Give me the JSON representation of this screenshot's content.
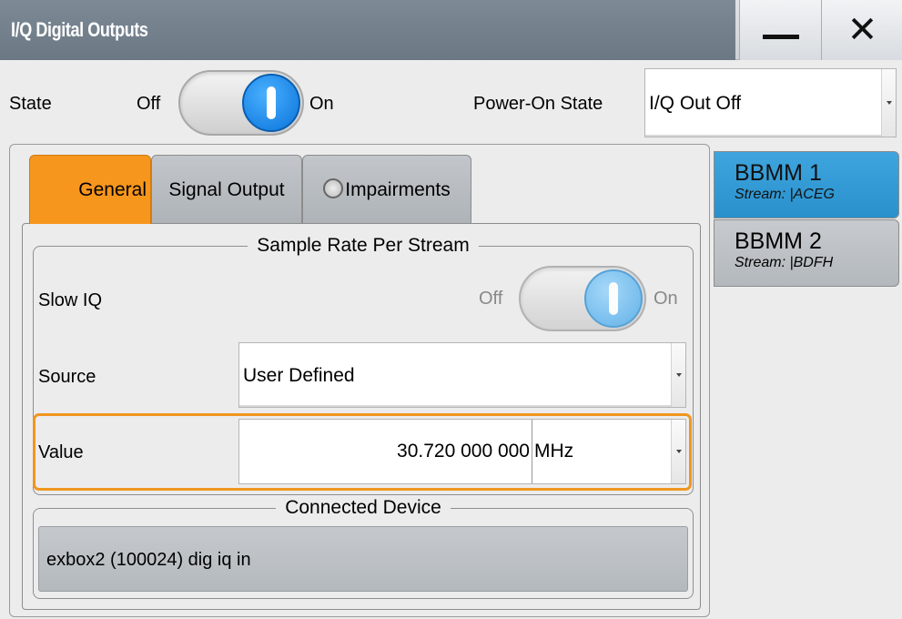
{
  "window": {
    "title": "I/Q Digital Outputs",
    "minimize_icon": "minimize-icon",
    "close_label": "✕"
  },
  "state": {
    "label": "State",
    "off_label": "Off",
    "on_label": "On",
    "value": "On"
  },
  "power_on_state": {
    "label": "Power-On State",
    "value": "I/Q Out Off"
  },
  "tabs": [
    {
      "label": "General",
      "active": true
    },
    {
      "label": "Signal Output",
      "active": false
    },
    {
      "label": "Impairments",
      "active": false,
      "icon": "indicator-circle-icon"
    }
  ],
  "sample_rate": {
    "title": "Sample Rate Per Stream",
    "slow_iq": {
      "label": "Slow IQ",
      "off_label": "Off",
      "on_label": "On",
      "value": "On"
    },
    "source": {
      "label": "Source",
      "value": "User Defined"
    },
    "value": {
      "label": "Value",
      "number": "30.720 000 000",
      "unit": "MHz"
    }
  },
  "connected_device": {
    "title": "Connected Device",
    "value": "exbox2 (100024) dig iq in"
  },
  "streams": [
    {
      "title": "BBMM 1",
      "subtitle": "Stream: |ACEG",
      "selected": true
    },
    {
      "title": "BBMM 2",
      "subtitle": "Stream: |BDFH",
      "selected": false
    }
  ],
  "colors": {
    "accent_orange": "#f7961d",
    "selected_blue": "#3fa5de",
    "toggle_knob": "#0a73d9"
  }
}
